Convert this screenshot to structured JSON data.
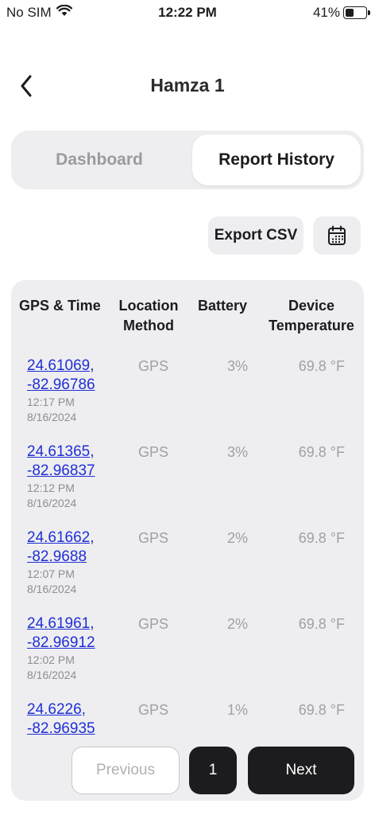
{
  "status_bar": {
    "carrier": "No SIM",
    "time": "12:22 PM",
    "battery_percent": "41%",
    "battery_level": 0.41
  },
  "nav": {
    "title": "Hamza 1",
    "back_icon": "chevron-left-icon"
  },
  "tabs": [
    {
      "label": "Dashboard",
      "active": false
    },
    {
      "label": "Report History",
      "active": true
    }
  ],
  "toolbar": {
    "export_label": "Export CSV",
    "calendar_icon": "calendar-icon"
  },
  "table": {
    "headers": {
      "gps_time": "GPS & Time",
      "location_method_1": "Location",
      "location_method_2": "Method",
      "battery": "Battery",
      "device_temp_1": "Device",
      "device_temp_2": "Temperature"
    },
    "rows": [
      {
        "lat": "24.61069,",
        "lng": "-82.96786",
        "time": "12:17 PM",
        "date": "8/16/2024",
        "method": "GPS",
        "battery": "3%",
        "temp": "69.8 °F"
      },
      {
        "lat": "24.61365,",
        "lng": "-82.96837",
        "time": "12:12 PM",
        "date": "8/16/2024",
        "method": "GPS",
        "battery": "3%",
        "temp": "69.8 °F"
      },
      {
        "lat": "24.61662,",
        "lng": "-82.9688",
        "time": "12:07 PM",
        "date": "8/16/2024",
        "method": "GPS",
        "battery": "2%",
        "temp": "69.8 °F"
      },
      {
        "lat": "24.61961,",
        "lng": "-82.96912",
        "time": "12:02 PM",
        "date": "8/16/2024",
        "method": "GPS",
        "battery": "2%",
        "temp": "69.8 °F"
      },
      {
        "lat": "24.6226,",
        "lng": "-82.96935",
        "time": "",
        "date": "",
        "method": "GPS",
        "battery": "1%",
        "temp": "69.8 °F"
      }
    ]
  },
  "pagination": {
    "previous_label": "Previous",
    "page": "1",
    "next_label": "Next"
  },
  "colors": {
    "link": "#1f2fd6",
    "card_bg": "#eeeef0",
    "primary_dark": "#1c1c1e",
    "muted_text": "#a0a0a6"
  }
}
